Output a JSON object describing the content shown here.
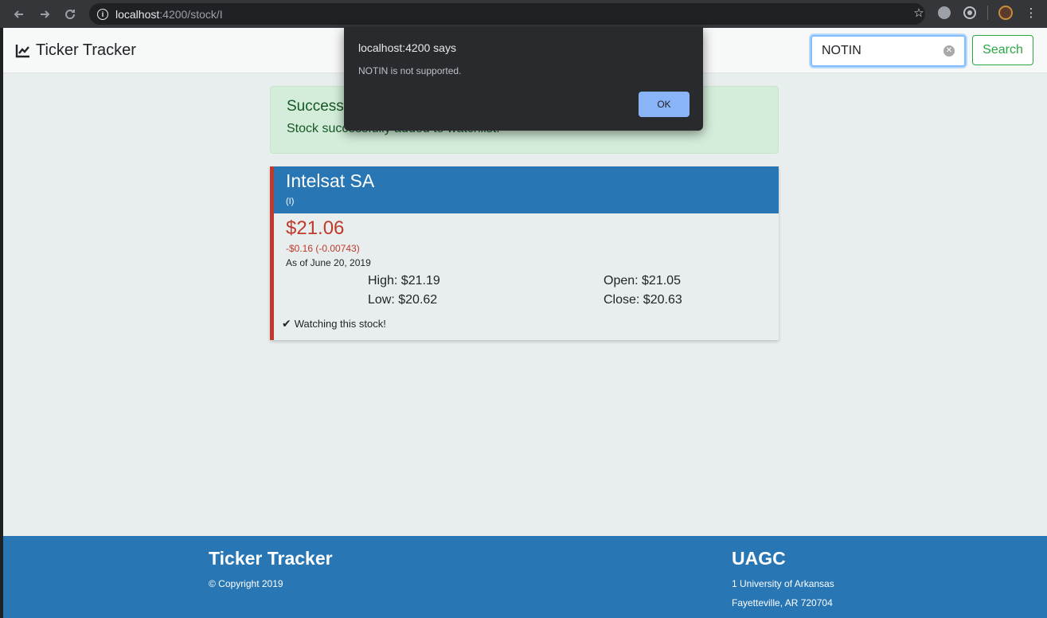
{
  "browser": {
    "url_host": "localhost",
    "url_rest": ":4200/stock/I"
  },
  "navbar": {
    "brand": "Ticker Tracker",
    "search_value": "NOTIN",
    "search_button": "Search"
  },
  "alert": {
    "title": "Success",
    "message": "Stock successfully added to watchlist."
  },
  "stock": {
    "name": "Intelsat SA",
    "symbol": "(I)",
    "price": "$21.06",
    "change": "-$0.16 (-0.00743)",
    "as_of": "As of June 20, 2019",
    "high": "High: $21.19",
    "low": "Low: $20.62",
    "open": "Open: $21.05",
    "close": "Close: $20.63",
    "watching": "Watching this stock!"
  },
  "footer": {
    "title": "Ticker Tracker",
    "copyright": "© Copyright 2019",
    "org": "UAGC",
    "address1": "1 University of Arkansas",
    "address2": "Fayetteville, AR 720704"
  },
  "dialog": {
    "title": "localhost:4200 says",
    "message": "NOTIN is not supported.",
    "ok": "OK"
  },
  "colors": {
    "primary": "#2876b3",
    "danger": "#c0392b",
    "success": "#28a745"
  }
}
